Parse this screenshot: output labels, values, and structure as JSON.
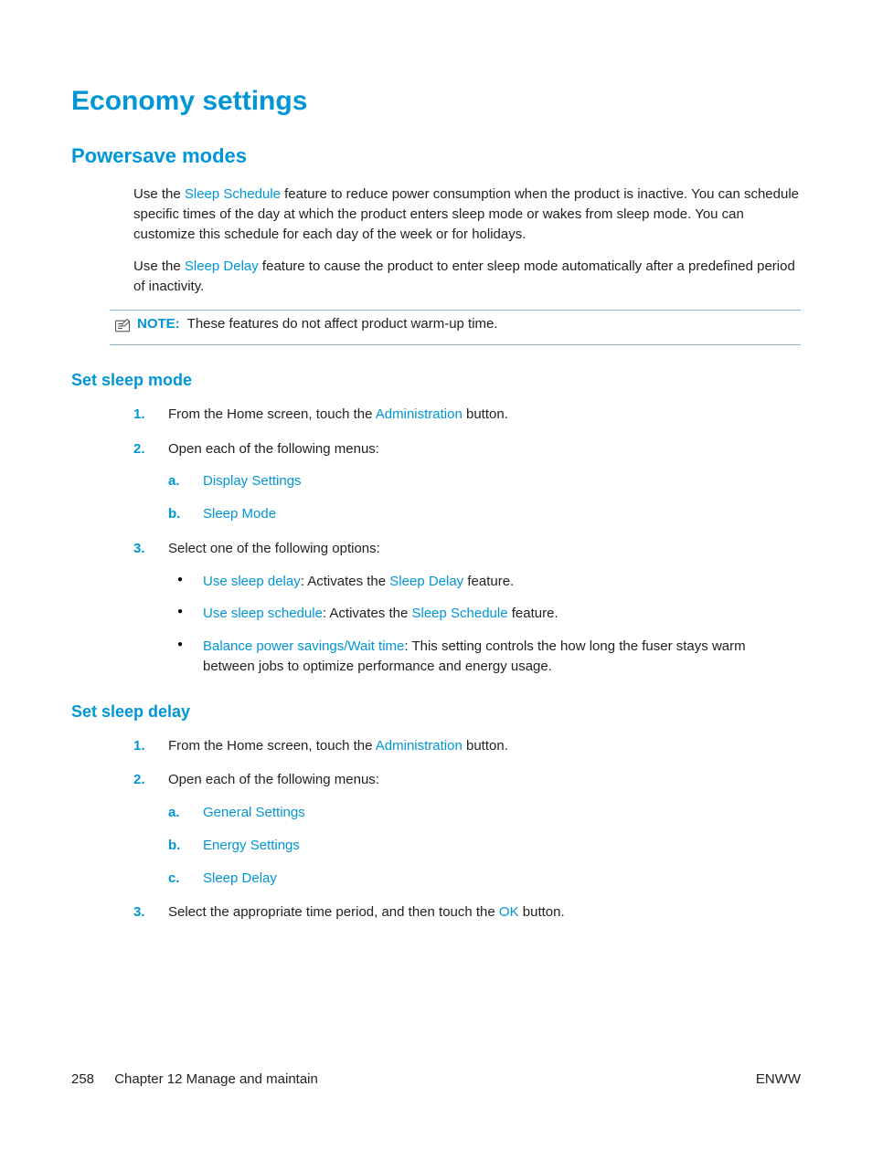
{
  "title": "Economy settings",
  "section_powersave": {
    "heading": "Powersave modes",
    "para1_pre": "Use the ",
    "para1_link": "Sleep Schedule",
    "para1_post": " feature to reduce power consumption when the product is inactive. You can schedule specific times of the day at which the product enters sleep mode or wakes from sleep mode. You can customize this schedule for each day of the week or for holidays.",
    "para2_pre": "Use the ",
    "para2_link": "Sleep Delay",
    "para2_post": " feature to cause the product to enter sleep mode automatically after a predefined period of inactivity.",
    "note_label": "NOTE:",
    "note_text": "These features do not affect product warm-up time."
  },
  "section_set_sleep_mode": {
    "heading": "Set sleep mode",
    "step1_pre": "From the Home screen, touch the ",
    "step1_link": "Administration",
    "step1_post": " button.",
    "step2": "Open each of the following menus:",
    "step2_a": "Display Settings",
    "step2_b": "Sleep Mode",
    "step3": "Select one of the following options:",
    "opt1_link": "Use sleep delay",
    "opt1_mid": ": Activates the ",
    "opt1_link2": "Sleep Delay",
    "opt1_post": " feature.",
    "opt2_link": "Use sleep schedule",
    "opt2_mid": ": Activates the ",
    "opt2_link2": "Sleep Schedule",
    "opt2_post": " feature.",
    "opt3_link": "Balance power savings/Wait time",
    "opt3_post": ": This setting controls the how long the fuser stays warm between jobs to optimize performance and energy usage."
  },
  "section_set_sleep_delay": {
    "heading": "Set sleep delay",
    "step1_pre": "From the Home screen, touch the ",
    "step1_link": "Administration",
    "step1_post": " button.",
    "step2": "Open each of the following menus:",
    "step2_a": "General Settings",
    "step2_b": "Energy Settings",
    "step2_c": "Sleep Delay",
    "step3_pre": "Select the appropriate time period, and then touch the ",
    "step3_link": "OK",
    "step3_post": " button."
  },
  "footer": {
    "page_number": "258",
    "chapter": "Chapter 12   Manage and maintain",
    "right": "ENWW"
  },
  "markers": {
    "n1": "1.",
    "n2": "2.",
    "n3": "3.",
    "a": "a.",
    "b": "b.",
    "c": "c."
  }
}
